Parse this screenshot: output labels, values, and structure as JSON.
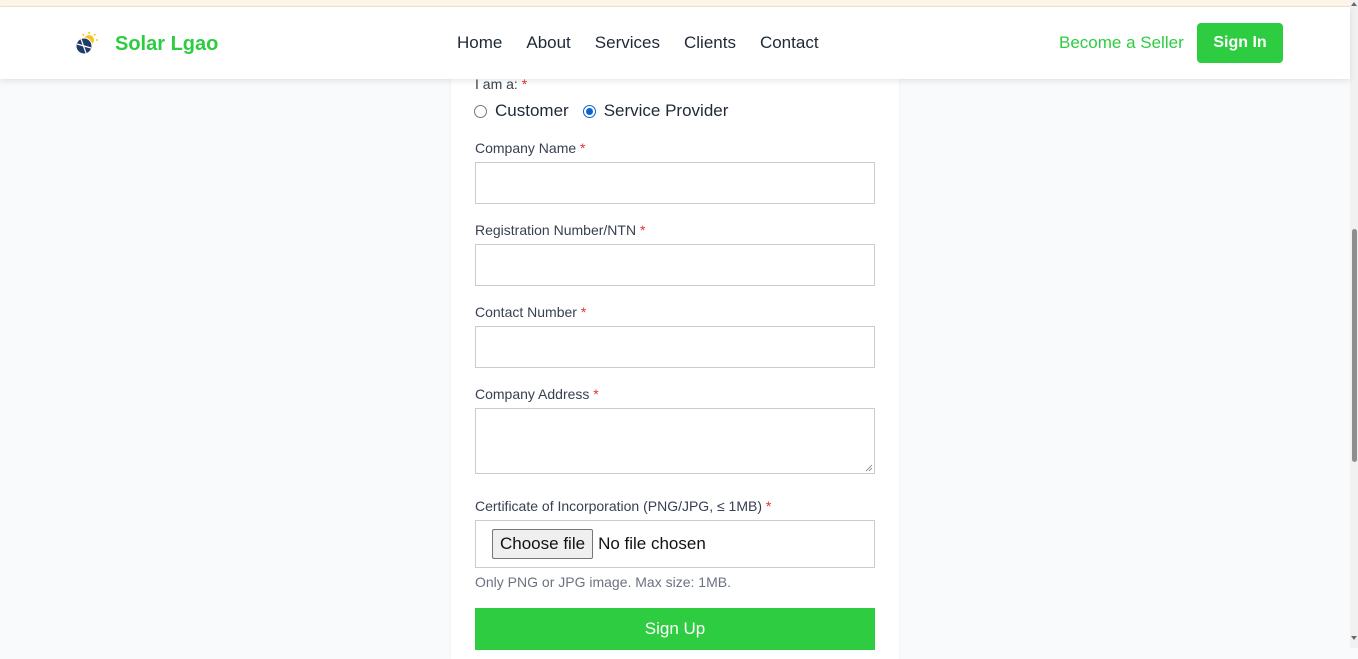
{
  "brand": {
    "name": "Solar Lgao",
    "logo_icon": "solar-panel-sun-icon"
  },
  "nav": {
    "links": [
      "Home",
      "About",
      "Services",
      "Clients",
      "Contact"
    ],
    "seller_label": "Become a Seller",
    "signin_label": "Sign In"
  },
  "form": {
    "role_label": "I am a:",
    "required_mark": "*",
    "roles": [
      {
        "label": "Customer",
        "selected": false
      },
      {
        "label": "Service Provider",
        "selected": true
      }
    ],
    "company_name_label": "Company Name",
    "company_name_value": "",
    "registration_label": "Registration Number/NTN",
    "registration_value": "",
    "contact_label": "Contact Number",
    "contact_value": "",
    "address_label": "Company Address",
    "address_value": "",
    "certificate_label": "Certificate of Incorporation (PNG/JPG, ≤ 1MB)",
    "file_button_label": "Choose file",
    "file_status": "No file chosen",
    "file_hint": "Only PNG or JPG image. Max size: 1MB.",
    "submit_label": "Sign Up"
  },
  "colors": {
    "accent": "#2ecc40",
    "required": "#e3342f",
    "radio_selected": "#0b63ce",
    "background": "#f8fafc"
  }
}
